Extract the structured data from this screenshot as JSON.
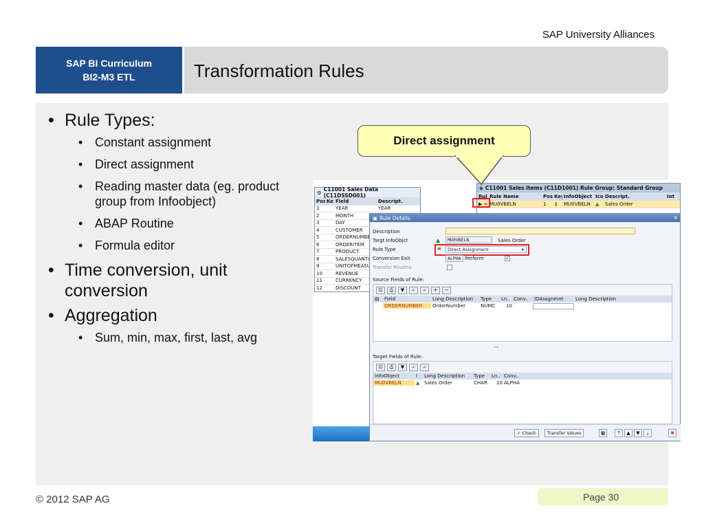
{
  "org": "SAP University Alliances",
  "curriculum": {
    "line1": "SAP BI Curriculum",
    "line2": "BI2-M3 ETL"
  },
  "title": "Transformation Rules",
  "bullets": {
    "rule_types": "Rule Types:",
    "rule_items": [
      "Constant assignment",
      "Direct assignment",
      "Reading master data (eg. product group from Infoobject)",
      "ABAP Routine",
      "Formula editor"
    ],
    "time_conv": "Time conversion, unit conversion",
    "aggregation": "Aggregation",
    "agg_items": [
      "Sum, min, max, first, last, avg"
    ]
  },
  "callout": "Direct assignment",
  "screenshot": {
    "source_title": "C11001 Sales Data (C11DSSD001)",
    "source_headers": [
      "Posi",
      "Ke",
      "Field",
      "Descript."
    ],
    "source_rows": [
      {
        "pos": "1",
        "field": "YEAR",
        "desc": "YEAR"
      },
      {
        "pos": "2",
        "field": "MONTH",
        "desc": ""
      },
      {
        "pos": "3",
        "field": "DAY",
        "desc": ""
      },
      {
        "pos": "4",
        "field": "CUSTOMER",
        "desc": ""
      },
      {
        "pos": "5",
        "field": "ORDERNUMBER",
        "desc": ""
      },
      {
        "pos": "6",
        "field": "ORDERITEM",
        "desc": ""
      },
      {
        "pos": "7",
        "field": "PRODUCT",
        "desc": ""
      },
      {
        "pos": "8",
        "field": "SALESQUANTITY",
        "desc": ""
      },
      {
        "pos": "9",
        "field": "UNITOFMEASURE",
        "desc": ""
      },
      {
        "pos": "10",
        "field": "REVENUE",
        "desc": ""
      },
      {
        "pos": "11",
        "field": "CURRENCY",
        "desc": ""
      },
      {
        "pos": "12",
        "field": "DISCOUNT",
        "desc": ""
      }
    ],
    "target_title": "C11001 Sales Items (C11D1001) Rule Group: Standard Group",
    "target_headers": [
      "Rul",
      "Rule Name",
      "Posi",
      "Key",
      "InfoObject",
      "Icor",
      "Descript.",
      "Int"
    ],
    "target_row": {
      "rule": "▶ =",
      "name": "MU0VBELN",
      "pos": "1",
      "key": "⚷",
      "io": "MU0VBELN",
      "desc": "Sales Order"
    },
    "dialog": {
      "title": "Rule Details",
      "close": "×",
      "labels": {
        "description": "Description",
        "target": "Targt InfoObjct",
        "rule_type": "Rule Type",
        "conv_exit": "Conversion Exit",
        "transfer": "Transfer Routine"
      },
      "target_value": "MU0VBELN",
      "target_desc": "Sales Order",
      "rule_type_value": "Direct Assignment",
      "rule_type_symbol": "=",
      "conv_value": "ALPHA",
      "conv_text": "Perform",
      "source_section": "Source Fields of Rule:",
      "source_headers": [
        "Field",
        "Long Description",
        "Type",
        "Ln..",
        "Conv..",
        "IOAssgnmnt",
        "Long Description"
      ],
      "source_row": {
        "field": "ORDERNUMBER",
        "long": "OrderNumber",
        "type": "NUMC",
        "len": "10"
      },
      "target_section": "Target Fields of Rule:",
      "target_headers": [
        "InfoObject",
        "I",
        "Long Description",
        "Type",
        "Ln..",
        "Conv.."
      ],
      "target_row": {
        "io": "MU0VBELN",
        "long": "Sales Order",
        "type": "CHAR",
        "len": "10",
        "conv": "ALPHA"
      },
      "buttons": {
        "check": "Check",
        "transfer": "Transfer Values"
      }
    }
  },
  "footer": {
    "copyright": "© 2012 SAP AG",
    "page": "Page 30"
  }
}
